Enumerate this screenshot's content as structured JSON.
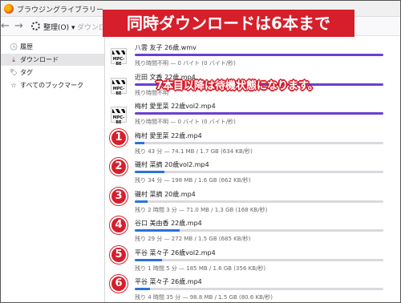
{
  "window": {
    "title": "ブラウジングライブラリー"
  },
  "toolbar": {
    "back_glyph": "←",
    "forward_glyph": "→",
    "organize_label": "整理(O) ▾",
    "search_placeholder": "ダウンロ"
  },
  "sidebar": {
    "items": [
      {
        "label": "履歴",
        "icon": "clock-icon",
        "glyph": "🕓"
      },
      {
        "label": "ダウンロード",
        "icon": "download-icon",
        "glyph": "⤓"
      },
      {
        "label": "タグ",
        "icon": "tag-icon",
        "glyph": "🏷"
      },
      {
        "label": "すべてのブックマーク",
        "icon": "star-icon",
        "glyph": "☆"
      }
    ]
  },
  "thumb_label": "MPC-BE",
  "downloads": [
    {
      "name": "八雲 友子 26歳.wmv",
      "status": "残り時間不明 — 0 バイト (0 バイト/秒)",
      "progress": 1.0,
      "color": "purple",
      "thumbnail": true
    },
    {
      "name": "近田 文香 22歳.mp4",
      "status": "残り時間不明",
      "progress": 1.0,
      "color": "purple",
      "thumbnail": true
    },
    {
      "name": "梅村 愛里菜 22歳vol2.mp4",
      "status": "残り時間不明 — 0 バイト (0 バイト/秒)",
      "progress": 1.0,
      "color": "purple",
      "thumbnail": true
    },
    {
      "name": "梅村 愛里菜 22歳.mp4",
      "status": "残り 43 分 — 74.1 MB / 1.7 GB (634 KB/秒)",
      "progress": 0.04,
      "color": "blue",
      "badge": "1"
    },
    {
      "name": "磯村 菜摘 20歳vol2.mp4",
      "status": "残り 34 分 — 198 MB / 1.6 GB (662 KB/秒)",
      "progress": 0.12,
      "color": "blue",
      "badge": "2"
    },
    {
      "name": "磯村 菜摘 20歳.mp4",
      "status": "残り 2 時間 3 分 — 71.0 MB / 1.3 GB (168 KB/秒)",
      "progress": 0.05,
      "color": "blue",
      "badge": "3"
    },
    {
      "name": "谷口 美由香 22歳.mp4",
      "status": "残り 29 分 — 272 MB / 1.5 GB (685 KB/秒)",
      "progress": 0.18,
      "color": "blue",
      "badge": "4"
    },
    {
      "name": "平谷 菜々子 26歳vol2.mp4",
      "status": "残り 1 時間 5 分 — 185 MB / 1.6 GB (356 KB/秒)",
      "progress": 0.11,
      "color": "blue",
      "badge": "5"
    },
    {
      "name": "平谷 菜々子 26歳.mp4",
      "status": "残り 4 時間 35 分 — 98.8 MB / 1.5 GB (80.6 KB/秒)",
      "progress": 0.06,
      "color": "blue",
      "badge": "6"
    }
  ],
  "overlay": {
    "headline": "同時ダウンロードは6本まで",
    "note": "7本目以降は待機状態になります。",
    "accent": "#d71e2b"
  }
}
